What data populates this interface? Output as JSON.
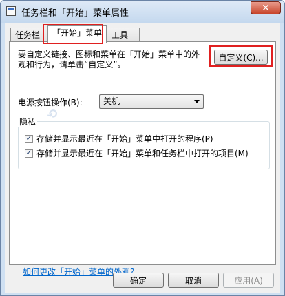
{
  "window": {
    "title": "任务栏和「开始」菜单属性",
    "close_glyph": "✕"
  },
  "tabs": [
    {
      "label": "任务栏",
      "active": false
    },
    {
      "label": "「开始」菜单",
      "active": true
    },
    {
      "label": "工具栏",
      "active": false
    }
  ],
  "start_menu": {
    "description": "要自定义链接、图标和菜单在「开始」菜单中的外观和行为，请单击“自定义”。",
    "customize_button": "自定义(C)...",
    "power_label": "电源按钮操作(B):",
    "power_value": "关机",
    "privacy_group": "隐私",
    "privacy_options": [
      {
        "label": "存储并显示最近在「开始」菜单中打开的程序(P)",
        "checked": true
      },
      {
        "label": "存储并显示最近在「开始」菜单和任务栏中打开的项目(M)",
        "checked": true
      }
    ],
    "help_link": "如何更改「开始」菜单的外观?"
  },
  "footer": {
    "ok": "确定",
    "cancel": "取消",
    "apply": "应用(A)"
  },
  "colors": {
    "highlight": "#e02020",
    "link": "#0066cc"
  }
}
